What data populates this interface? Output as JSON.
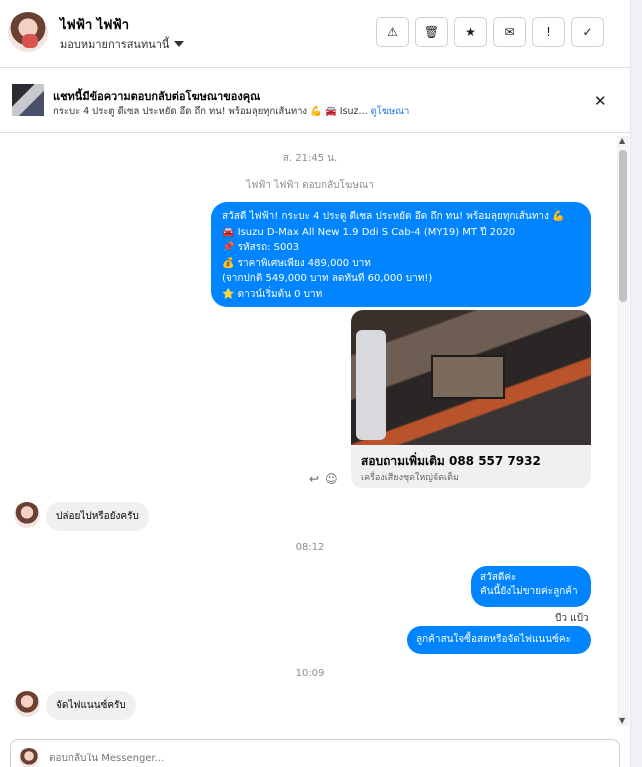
{
  "header": {
    "name": "ไฟฟ้า ไฟฟ้า",
    "assign_label": "มอบหมายการสนทนานี้",
    "actions": [
      {
        "icon": "warning-icon",
        "glyph": "⚠"
      },
      {
        "icon": "trash-icon",
        "glyph": "🗑"
      },
      {
        "icon": "star-icon",
        "glyph": "★"
      },
      {
        "icon": "mark-unread-icon",
        "glyph": "✉"
      },
      {
        "icon": "follow-up-icon",
        "glyph": "!"
      },
      {
        "icon": "done-check-icon",
        "glyph": "✓"
      }
    ]
  },
  "ad": {
    "title": "แชทนี้มีข้อความตอบกลับต่อโฆษณาของคุณ",
    "subtitle": "กระบะ 4 ประตู ดีเซล ประหยัด อึด ถึก ทน! พร้อมลุยทุกเส้นทาง 💪 🚘 Isuz...",
    "link": "ดูโฆษณา"
  },
  "messages": {
    "time1": "ส. 21:45 น.",
    "ad_reply_note": "ไฟฟ้า ไฟฟ้า ตอบกลับโฆษณา",
    "ad_message": [
      "สวัสดี ไฟฟ้า! กระบะ 4 ประตู ดีเซล ประหยัด อึด ถึก ทน! พร้อมลุยทุกเส้นทาง 💪",
      "🚘 Isuzu D-Max All New 1.9 Ddi S Cab-4 (MY19) MT ปี 2020",
      "📌 รหัสรถ: S003",
      "💰 ราคาพิเศษเพียง 489,000 บาท",
      "(จากปกติ 549,000 บาท ลดทันที 60,000 บาท!)",
      "⭐ ดาวน์เริ่มต้น 0 บาท"
    ],
    "card_title": "สอบถามเพิ่มเติม 088 557 7932",
    "card_subtitle": "เครื่องเสียงชุดใหญ่จัดเต็ม",
    "in1": "ปล่อยไปหรือยังครับ",
    "time2": "08:12",
    "out1_line1": "สวัสดีค่ะ",
    "out1_line2": "คันนี้ยังไม่ขายค่ะลูกค้า",
    "sender_name": "บีว แป้ว",
    "out2": "ลูกค้าสนใจซื้อสดหรือจัดไฟแนนซ์คะ",
    "time3": "10:09",
    "in2": "จัดไฟแนนซ์ครับ"
  },
  "composer": {
    "placeholder": "ตอบกลับใน Messenger..."
  },
  "colors": {
    "outgoing_bubble": "#0084ff",
    "incoming_bubble": "#f0f0f0",
    "link": "#1b74e4"
  }
}
